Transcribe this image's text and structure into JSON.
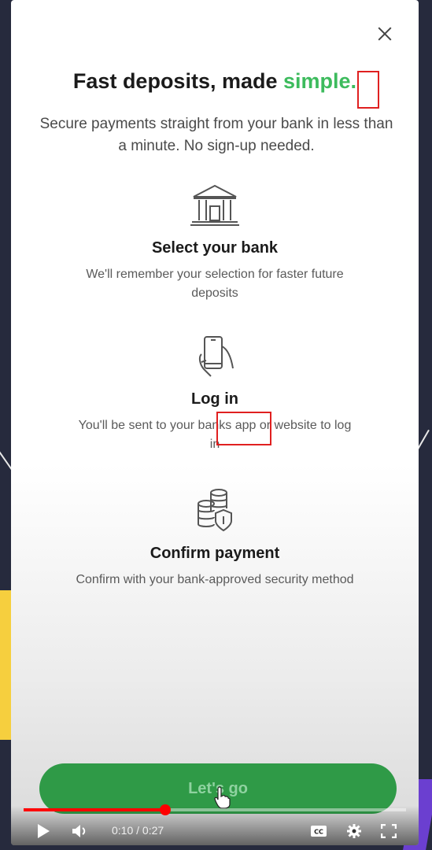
{
  "modal": {
    "title_main": "Fast deposits, made ",
    "title_accent": "simple",
    "title_period": ".",
    "subtitle": "Secure payments straight from your bank in less than a minute. No sign-up needed.",
    "steps": [
      {
        "icon": "bank-icon",
        "title": "Select your bank",
        "desc": "We'll remember your selection for faster future deposits"
      },
      {
        "icon": "phone-hand-icon",
        "title": "Log in",
        "desc": "You'll be sent to your banks app or website to log in"
      },
      {
        "icon": "coins-shield-icon",
        "title": "Confirm payment",
        "desc": "Confirm with your bank-approved security method"
      }
    ],
    "cta_label": "Let's go"
  },
  "player": {
    "current_time": "0:10",
    "duration": "0:27",
    "time_display": "0:10 / 0:27",
    "progress_fraction": 0.37,
    "accent": "#ff0000"
  },
  "colors": {
    "accent_green": "#3dbb5d",
    "cta_green": "#2f9a47",
    "highlight_red": "#e02020"
  }
}
